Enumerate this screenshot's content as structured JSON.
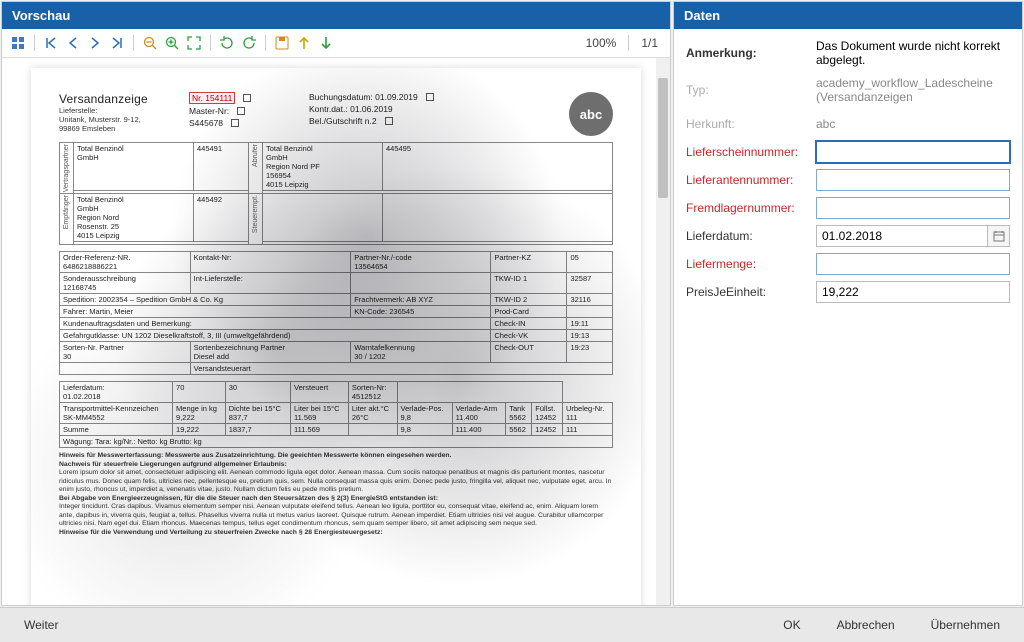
{
  "preview": {
    "title": "Vorschau",
    "zoom": "100%",
    "page": "1/1"
  },
  "data_panel": {
    "title": "Daten",
    "annotation_label": "Anmerkung:",
    "annotation_value": "Das Dokument wurde nicht korrekt abgelegt.",
    "fields": {
      "typ_label": "Typ:",
      "typ_value": "academy_workflow_Ladescheine (Versandanzeigen",
      "herkunft_label": "Herkunft:",
      "herkunft_value": "abc",
      "lieferscheinnr_label": "Lieferscheinnummer:",
      "lieferscheinnr_value": "",
      "lieferantennr_label": "Lieferantennummer:",
      "lieferantennr_value": "",
      "fremdlagernr_label": "Fremdlagernummer:",
      "fremdlagernr_value": "",
      "lieferdatum_label": "Lieferdatum:",
      "lieferdatum_value": "01.02.2018",
      "liefermenge_label": "Liefermenge:",
      "liefermenge_value": "",
      "preis_label": "PreisJeEinheit:",
      "preis_value": "19,222"
    }
  },
  "footer": {
    "weiter": "Weiter",
    "ok": "OK",
    "abbrechen": "Abbrechen",
    "uebernehmen": "Übernehmen"
  },
  "doc": {
    "title": "Versandanzeige",
    "lieferstelle": "Lieferstelle:",
    "address1": "Unitank, Musterstr. 9-12,",
    "address2": "99869 Emsleben",
    "box_nr1": "Nr. 154111",
    "box_master": "Master-Nr:",
    "box_nr2": "S445678",
    "box_buchung": "Buchungsdatum: 01.09.2019",
    "box_kontr": "Kontr.dat.: 01.06.2019",
    "box_gut": "Bel./Gutschrift n.2",
    "abc": "abc",
    "t1": {
      "r1c1_a": "Total Benzinöl",
      "r1c1_b": "GmbH",
      "r1c2": "445491",
      "r1c3_a": "Total Benzinöl",
      "r1c3_b": "GmbH",
      "r1c3_c": "Region Nord PF",
      "r1c3_d": "156954",
      "r1c3_e": "4015 Leipzig",
      "r1c4": "445495",
      "r2c1_a": "Total Benzinöl",
      "r2c1_b": "GmbH",
      "r2c1_c": "Region Nord",
      "r2c1_d": "Rosenstr. 25",
      "r2c1_e": "4015 Leipzig",
      "r2c2": "445492",
      "vlabel1": "Vertragspartner",
      "vlabel2": "Empfänger",
      "vlabel3": "Abrufer",
      "vlabel4": "Steuerempf."
    },
    "t2": {
      "r1a": "Order-Referenz-NR.",
      "r1b": "6486218886221",
      "r1c": "Kontakt-Nr:",
      "r1d": "Partner-Nr./-code",
      "r1e": "13564654",
      "r1f": "Partner-KZ",
      "r1g": "05",
      "r2a": "Sonderausschreibung",
      "r2b": "12168745",
      "r2c": "Int-Lieferstelle:",
      "r2d": "TKW-ID 1",
      "r2e": "32587",
      "r3a": "Spedition: 2002354 – Spedition GmbH & Co. Kg",
      "r3b": "Frachtvermerk: AB XYZ",
      "r3c": "TKW-ID 2",
      "r3d": "32116",
      "r4a": "Fahrer: Martin, Meier",
      "r4b": "KN-Code: 236545",
      "r4c": "Prod-Card",
      "r5a": "Kundenauftragsdaten und Bemerkung:",
      "r5b": "Check-IN",
      "r5c": "19:11",
      "r6a": "Gefahrgutklasse: UN 1202 Dieselkraftstoff, 3, III (umweltgefährdend)",
      "r6b": "Check-VK",
      "r6c": "19:13",
      "r7a": "Sorten-Nr. Partner",
      "r7b": "30",
      "r7c": "Sortenbezeichnung Partner",
      "r7d": "Diesel add",
      "r7e": "Warntafelkennung",
      "r7f": "30 / 1202",
      "r7g": "Check-OUT",
      "r7h": "19:23",
      "r8a": "Versandsteuerart",
      "r9a": "Lieferdatum:",
      "r9b": "01.02.2018",
      "r9c": "70",
      "r9d": "30",
      "r9e": "Versteuert",
      "r9f": "Sorten-Nr:",
      "r9g": "4512512",
      "r10a": "Transportmittel-Kennzeichen",
      "r10b": "SK-MM4552",
      "r10c": "Menge in kg",
      "r10d": "9,222",
      "r10e": "Dichte bei 15°C",
      "r10f": "837,7",
      "r10g": "Liter bei 15°C",
      "r10h": "11.569",
      "r10i": "Liter akt.°C",
      "r10j": "26°C",
      "r10k": "Verlade-Pos.",
      "r10l": "9,8",
      "r10m": "Verlade-Arm",
      "r10n": "11.400",
      "r10o": "Tank",
      "r10p": "5562",
      "r10q": "Füllst.",
      "r10r": "12452",
      "r10s": "Urbeleg-Nr.",
      "r10t": "111",
      "r11a": "Summe",
      "r11b": "19,222",
      "r11c": "1837,7",
      "r11d": "111.569",
      "r11e": "9,8",
      "r11f": "111.400",
      "r11g": "5562",
      "r11h": "12452",
      "r11i": "111",
      "r12": "Wägung:   Tara:   kg/Nr.:           Netto:        kg    Brutto:        kg"
    },
    "txt": {
      "h1": "Hinweis für Messwerterfassung: Messwerte aus Zusatzeinrichtung. Die geeichten Messwerte können eingesehen werden.",
      "h2": "Nachweis für steuerfreie Liegerungen aufgrund allgemeiner Erlaubnis:",
      "p1": "Lorem ipsum dolor sit amet, consectetuer adipiscing elit. Aenean commodo ligula eget dolor. Aenean massa. Cum sociis natoque penatibus et magnis dis parturient montes, nascetur ridiculus mus. Donec quam felis, ultricies nec, pellentesque eu, pretium quis, sem. Nulla consequat massa quis enim. Donec pede justo, fringilla vel, aliquet nec, vulputate eget, arcu. In enim justo, rhoncus ut, imperdiet a, venenatis vitae, justo. Nullam dictum felis eu pede mollis pretium.",
      "h3": "Bei Abgabe von Energieerzeugnissen, für die die Steuer nach den Steuersätzen des § 2(3) EnergieStG entstanden ist:",
      "p2": "Integer tincidunt. Cras dapibus. Vivamus elementum semper nisi. Aenean vulputate eleifend tellus. Aenean leo ligula, porttitor eu, consequat vitae, eleifend ac, enim. Aliquam lorem ante, dapibus in, viverra quis, feugiat a, tellus. Phasellus viverra nulla ut metus varius laoreet. Quisque rutrum. Aenean imperdiet. Etiam ultricies nisi vel augue. Curabitur ullamcorper ultricies nisi. Nam eget dui. Etiam rhoncus. Maecenas tempus, tellus eget condimentum rhoncus, sem quam semper libero, sit amet adipiscing sem neque sed.",
      "h4": "Hinweise für die Verwendung und Verteilung zu steuerfreien Zwecke nach § 28 Energiesteuergesetz:"
    }
  }
}
